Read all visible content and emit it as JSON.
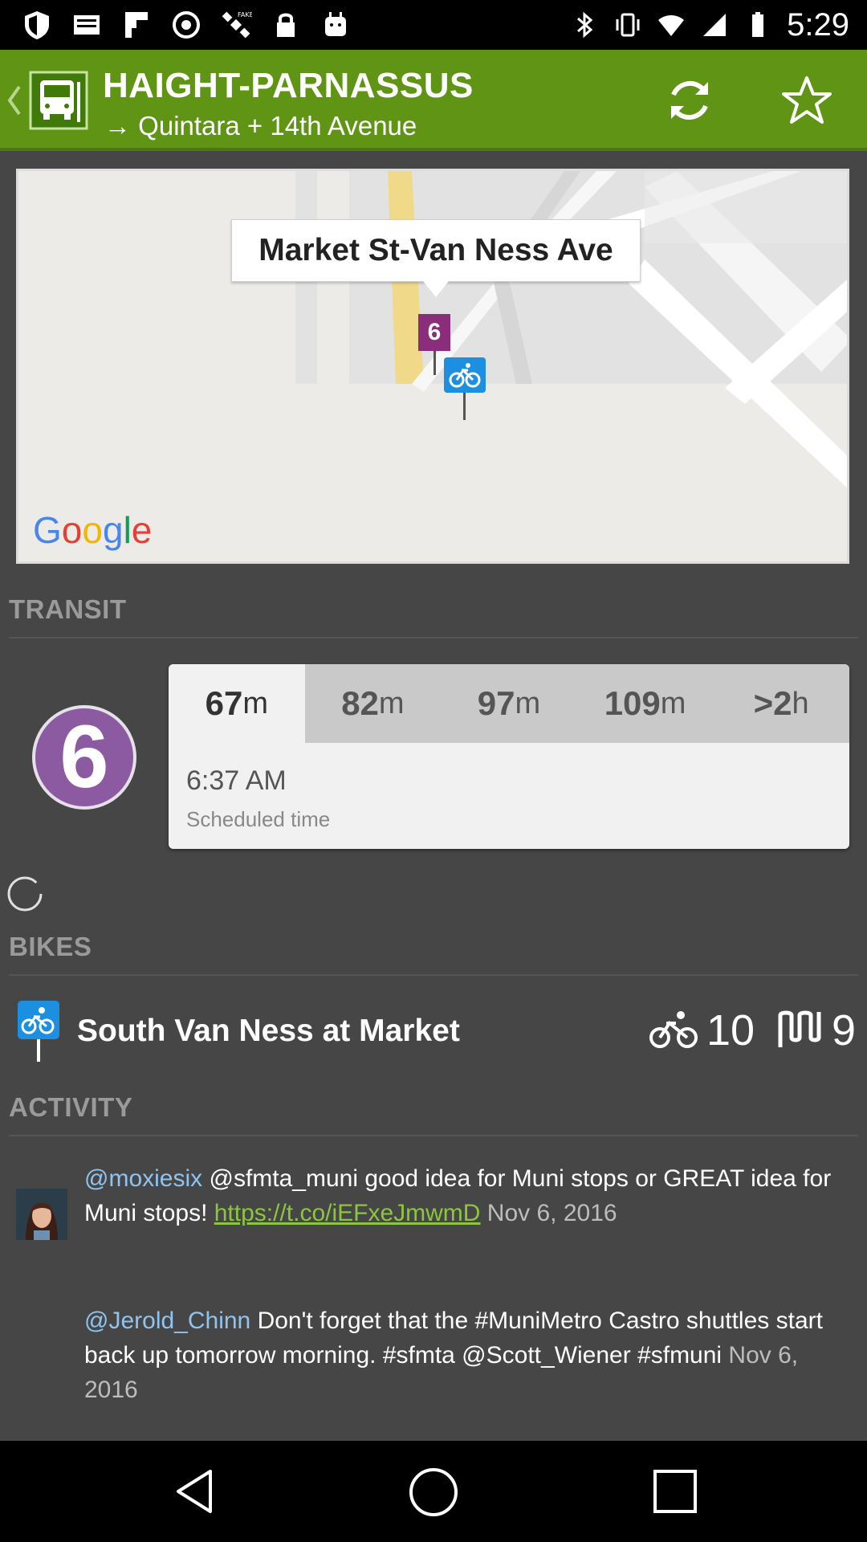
{
  "status_bar": {
    "time": "5:29",
    "icons": [
      "shield-icon",
      "mail-icon",
      "flipboard-icon",
      "camera-icon",
      "satellite-icon",
      "fake-gps-icon",
      "lock-icon",
      "android-icon",
      "bluetooth-icon",
      "vibrate-icon",
      "wifi-icon",
      "signal-icon",
      "battery-icon"
    ]
  },
  "app_bar": {
    "title": "HAIGHT-PARNASSUS",
    "subtitle": "→ Quintara + 14th Avenue",
    "color": "#5f9414"
  },
  "map": {
    "callout": "Market St-Van Ness Ave",
    "stop_marker": "6",
    "logo": [
      "G",
      "o",
      "o",
      "g",
      "l",
      "e"
    ]
  },
  "transit": {
    "header": "TRANSIT",
    "route_number": "6",
    "route_color": "#8c5aa0",
    "tabs": [
      {
        "value": "67",
        "unit": "m",
        "active": true
      },
      {
        "value": "82",
        "unit": "m",
        "active": false
      },
      {
        "value": "97",
        "unit": "m",
        "active": false
      },
      {
        "value": "109",
        "unit": "m",
        "active": false
      },
      {
        "value": ">2",
        "unit": "h",
        "active": false
      }
    ],
    "selected_time": "6:37 AM",
    "selected_time_label": "Scheduled time"
  },
  "bikes": {
    "header": "BIKES",
    "station_name": "South Van Ness at Market",
    "bikes_available": "10",
    "docks_available": "9"
  },
  "activity": {
    "header": "ACTIVITY",
    "tweets": [
      {
        "handle": "@moxiesix",
        "text": " @sfmta_muni good idea for Muni stops or GREAT idea for Muni stops! ",
        "link": "https://t.co/iEFxeJmwmD",
        "date": " Nov 6, 2016"
      },
      {
        "handle": "@Jerold_Chinn",
        "text": " Don't forget that the #MuniMetro Castro shuttles start back up tomorrow morning. #sfmta @Scott_Wiener #sfmuni",
        "date": " Nov 6, 2016"
      }
    ]
  }
}
